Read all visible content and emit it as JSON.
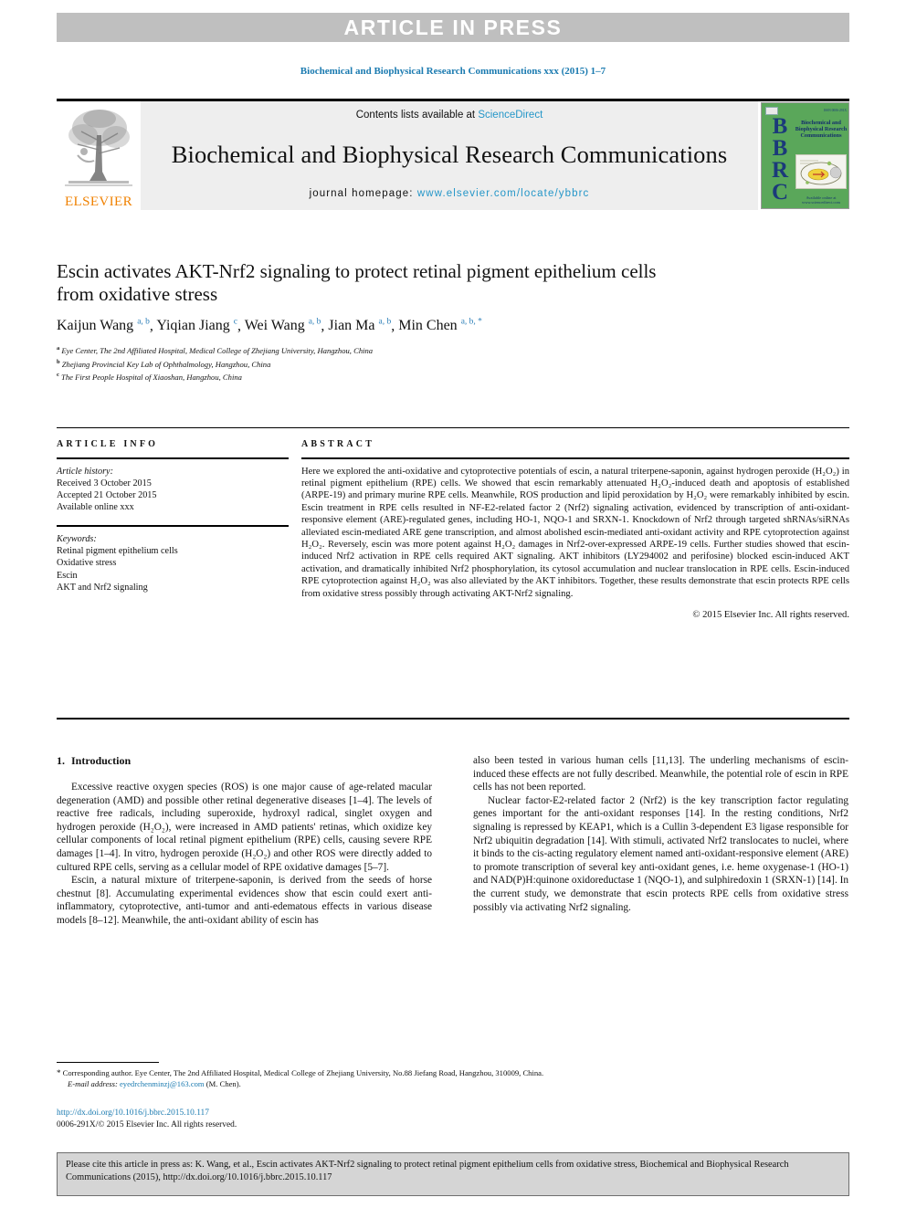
{
  "banner": {
    "text": "ARTICLE IN PRESS"
  },
  "running_head": "Biochemical and Biophysical Research Communications xxx (2015) 1–7",
  "masthead": {
    "contents_prefix": "Contents lists available at ",
    "contents_link": "ScienceDirect",
    "journal_title": "Biochemical and Biophysical Research Communications",
    "homepage_prefix": "journal homepage: ",
    "homepage_url": "www.elsevier.com/locate/ybbrc",
    "publisher_wordmark": "ELSEVIER",
    "cover": {
      "letters": "BBRC",
      "title": "Biochemical and Biophysical Research Communications",
      "footer": "Available online at www.sciencedirect.com"
    }
  },
  "article": {
    "title": "Escin activates AKT-Nrf2 signaling to protect retinal pigment epithelium cells from oxidative stress",
    "authors": [
      {
        "name": "Kaijun Wang",
        "marks": "a, b"
      },
      {
        "name": "Yiqian Jiang",
        "marks": "c"
      },
      {
        "name": "Wei Wang",
        "marks": "a, b"
      },
      {
        "name": "Jian Ma",
        "marks": "a, b"
      },
      {
        "name": "Min Chen",
        "marks": "a, b, *"
      }
    ],
    "affiliations": [
      {
        "mark": "a",
        "text": "Eye Center, The 2nd Affiliated Hospital, Medical College of Zhejiang University, Hangzhou, China"
      },
      {
        "mark": "b",
        "text": "Zhejiang Provincial Key Lab of Ophthalmology, Hangzhou, China"
      },
      {
        "mark": "c",
        "text": "The First People Hospital of Xiaoshan, Hangzhou, China"
      }
    ]
  },
  "article_info": {
    "heading": "ARTICLE INFO",
    "history_label": "Article history:",
    "history": [
      "Received 3 October 2015",
      "Accepted 21 October 2015",
      "Available online xxx"
    ],
    "keywords_label": "Keywords:",
    "keywords": [
      "Retinal pigment epithelium cells",
      "Oxidative stress",
      "Escin",
      "AKT and Nrf2 signaling"
    ]
  },
  "abstract": {
    "heading": "ABSTRACT",
    "text": "Here we explored the anti-oxidative and cytoprotective potentials of escin, a natural triterpene-saponin, against hydrogen peroxide (H₂O₂) in retinal pigment epithelium (RPE) cells. We showed that escin remarkably attenuated H₂O₂-induced death and apoptosis of established (ARPE-19) and primary murine RPE cells. Meanwhile, ROS production and lipid peroxidation by H₂O₂ were remarkably inhibited by escin. Escin treatment in RPE cells resulted in NF-E2-related factor 2 (Nrf2) signaling activation, evidenced by transcription of anti-oxidant-responsive element (ARE)-regulated genes, including HO-1, NQO-1 and SRXN-1. Knockdown of Nrf2 through targeted shRNAs/siRNAs alleviated escin-mediated ARE gene transcription, and almost abolished escin-mediated anti-oxidant activity and RPE cytoprotection against H₂O₂. Reversely, escin was more potent against H₂O₂ damages in Nrf2-over-expressed ARPE-19 cells. Further studies showed that escin-induced Nrf2 activation in RPE cells required AKT signaling. AKT inhibitors (LY294002 and perifosine) blocked escin-induced AKT activation, and dramatically inhibited Nrf2 phosphorylation, its cytosol accumulation and nuclear translocation in RPE cells. Escin-induced RPE cytoprotection against H₂O₂ was also alleviated by the AKT inhibitors. Together, these results demonstrate that escin protects RPE cells from oxidative stress possibly through activating AKT-Nrf2 signaling.",
    "copyright": "© 2015 Elsevier Inc. All rights reserved."
  },
  "introduction": {
    "number": "1.",
    "heading": "Introduction",
    "left_paragraphs": [
      "Excessive reactive oxygen species (ROS) is one major cause of age-related macular degeneration (AMD) and possible other retinal degenerative diseases [1–4]. The levels of reactive free radicals, including superoxide, hydroxyl radical, singlet oxygen and hydrogen peroxide (H₂O₂), were increased in AMD patients' retinas, which oxidize key cellular components of local retinal pigment epithelium (RPE) cells, causing severe RPE damages [1–4]. In vitro, hydrogen peroxide (H₂O₂) and other ROS were directly added to cultured RPE cells, serving as a cellular model of RPE oxidative damages [5–7].",
      "Escin, a natural mixture of triterpene-saponin, is derived from the seeds of horse chestnut [8]. Accumulating experimental evidences show that escin could exert anti-inflammatory, cytoprotective, anti-tumor and anti-edematous effects in various disease models [8–12]. Meanwhile, the anti-oxidant ability of escin has"
    ],
    "right_paragraphs": [
      "also been tested in various human cells [11,13]. The underling mechanisms of escin-induced these effects are not fully described. Meanwhile, the potential role of escin in RPE cells has not been reported.",
      "Nuclear factor-E2-related factor 2 (Nrf2) is the key transcription factor regulating genes important for the anti-oxidant responses [14]. In the resting conditions, Nrf2 signaling is repressed by KEAP1, which is a Cullin 3-dependent E3 ligase responsible for Nrf2 ubiquitin degradation [14]. With stimuli, activated Nrf2 translocates to nuclei, where it binds to the cis-acting regulatory element named anti-oxidant-responsive element (ARE) to promote transcription of several key anti-oxidant genes, i.e. heme oxygenase-1 (HO-1) and NAD(P)H:quinone oxidoreductase 1 (NQO-1), and sulphiredoxin 1 (SRXN-1) [14]. In the current study, we demonstrate that escin protects RPE cells from oxidative stress possibly via activating Nrf2 signaling."
    ]
  },
  "footnote": {
    "star": "*",
    "corresponding": "Corresponding author. Eye Center, The 2nd Affiliated Hospital, Medical College of Zhejiang University, No.88 Jiefang Road, Hangzhou, 310009, China.",
    "email_label": "E-mail address:",
    "email": "eyedrchenminzj@163.com",
    "email_suffix": "(M. Chen)."
  },
  "doi_url": "http://dx.doi.org/10.1016/j.bbrc.2015.10.117",
  "issn_line": "0006-291X/© 2015 Elsevier Inc. All rights reserved.",
  "cite_box": "Please cite this article in press as: K. Wang, et al., Escin activates AKT-Nrf2 signaling to protect retinal pigment epithelium cells from oxidative stress, Biochemical and Biophysical Research Communications (2015), http://dx.doi.org/10.1016/j.bbrc.2015.10.117",
  "colors": {
    "link": "#1a7ab0",
    "sciencedirect": "#2496c8",
    "banner_bg": "#bfbfbf",
    "masthead_bg": "#eeeeee",
    "elsevier_orange": "#f08100",
    "cover_green": "#5aa75a",
    "cite_box_bg": "#d5d5d5"
  }
}
